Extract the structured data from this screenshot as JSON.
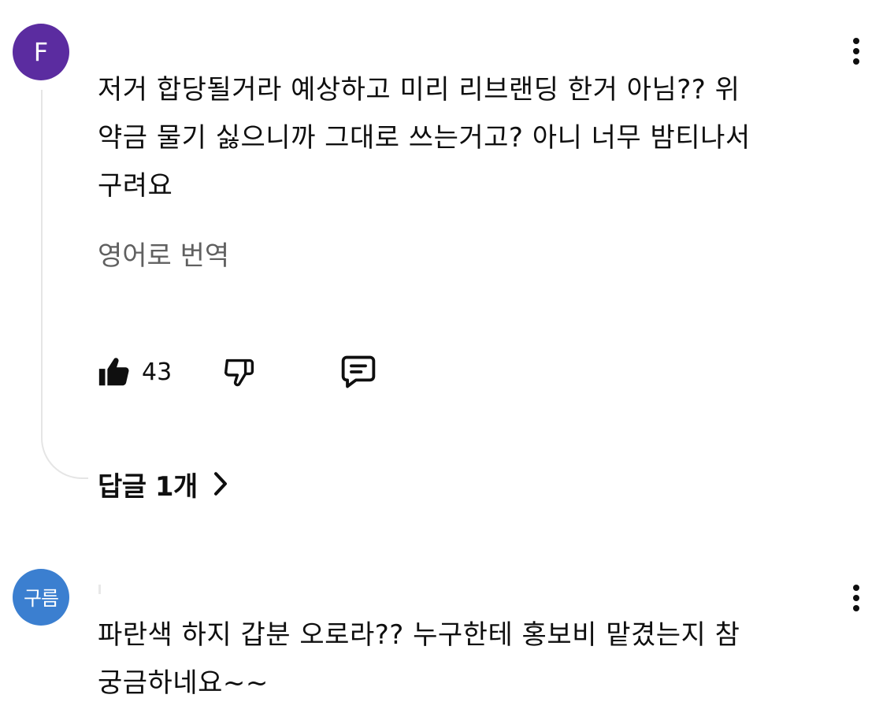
{
  "comments": [
    {
      "avatar_text": "F",
      "avatar_color": "#5b2ca0",
      "text": "저거 합당될거라 예상하고 미리 리브랜딩 한거 아님?? 위\n약금 물기 싫으니까 그대로 쓰는거고? 아니 너무 밤티나서\n구려요",
      "translate_label": "영어로 번역",
      "like_count": "43",
      "replies_label": "답글 1개"
    },
    {
      "avatar_text": "구름",
      "avatar_color": "#3b7fd0",
      "text": "파란색 하지 갑분 오로라?? 누구한테 홍보비 맡겼는지 참\n궁금하네요~~"
    }
  ],
  "icons": {
    "like": "thumbs-up-filled-icon",
    "dislike": "thumbs-down-outline-icon",
    "reply": "comment-reply-icon",
    "more": "more-vertical-icon",
    "chevron": "chevron-right-icon"
  }
}
